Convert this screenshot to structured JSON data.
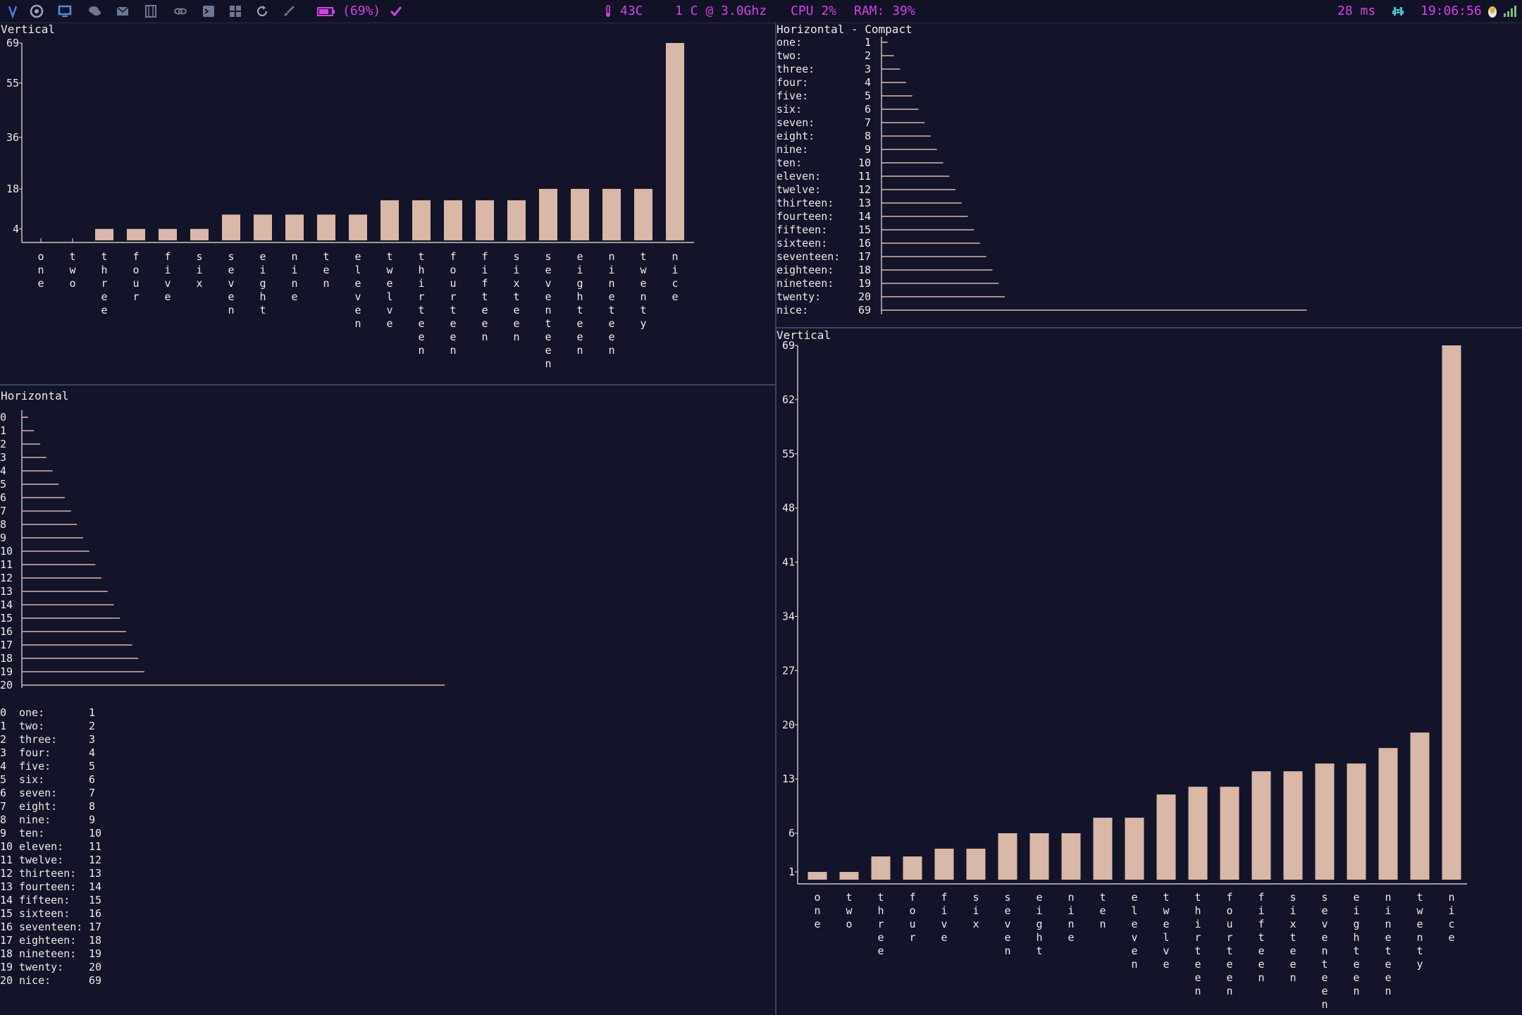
{
  "statusbar": {
    "battery": "(69%)",
    "temperature": "43C",
    "cpu_freq": "1 C @ 3.0Ghz",
    "cpu": "CPU 2%",
    "ram": "RAM: 39%",
    "latency": "28 ms",
    "clock": "19:06:56",
    "icons": [
      "vim-icon",
      "chrome-icon",
      "monitor-icon",
      "chat-icon",
      "mail-icon",
      "film-icon",
      "link-icon",
      "terminal-icon",
      "windows-icon",
      "refresh-icon",
      "brush-icon"
    ]
  },
  "colors": {
    "background": "#13132a",
    "bar": "#d9b8a8",
    "text": "#f2ebe2",
    "accent": "#d443e6",
    "separator": "#3c4460"
  },
  "panes": {
    "top_left": {
      "title": "Vertical"
    },
    "bottom_left": {
      "title": "Horizontal"
    },
    "top_right": {
      "title": "Horizontal - Compact"
    },
    "bottom_right": {
      "title": "Vertical"
    }
  },
  "chart_data": [
    {
      "type": "bar",
      "orientation": "vertical",
      "categories": [
        "one",
        "two",
        "three",
        "four",
        "five",
        "six",
        "seven",
        "eight",
        "nine",
        "ten",
        "eleven",
        "twelve",
        "thirteen",
        "fourteen",
        "fifteen",
        "sixteen",
        "seventeen",
        "eighteen",
        "nineteen",
        "twenty",
        "nice"
      ],
      "values": [
        0,
        0,
        4,
        4,
        4,
        4,
        9,
        9,
        9,
        9,
        9,
        14,
        14,
        14,
        14,
        14,
        18,
        18,
        18,
        18,
        69
      ],
      "yticks": [
        4,
        18,
        36,
        55,
        69
      ],
      "ylim": [
        0,
        69
      ]
    },
    {
      "type": "bar",
      "orientation": "horizontal",
      "categories": [
        "0",
        "1",
        "2",
        "3",
        "4",
        "5",
        "6",
        "7",
        "8",
        "9",
        "10",
        "11",
        "12",
        "13",
        "14",
        "15",
        "16",
        "17",
        "18",
        "19",
        "20"
      ],
      "values": [
        1,
        2,
        3,
        4,
        5,
        6,
        7,
        8,
        9,
        10,
        11,
        12,
        13,
        14,
        15,
        16,
        17,
        18,
        19,
        20,
        69
      ],
      "table": {
        "index": [
          "0",
          "1",
          "2",
          "3",
          "4",
          "5",
          "6",
          "7",
          "8",
          "9",
          "10",
          "11",
          "12",
          "13",
          "14",
          "15",
          "16",
          "17",
          "18",
          "19",
          "20"
        ],
        "labels": [
          "one:",
          "two:",
          "three:",
          "four:",
          "five:",
          "six:",
          "seven:",
          "eight:",
          "nine:",
          "ten:",
          "eleven:",
          "twelve:",
          "thirteen:",
          "fourteen:",
          "fifteen:",
          "sixteen:",
          "seventeen:",
          "eighteen:",
          "nineteen:",
          "twenty:",
          "nice:"
        ],
        "values": [
          "1",
          "2",
          "3",
          "4",
          "5",
          "6",
          "7",
          "8",
          "9",
          "10",
          "11",
          "12",
          "13",
          "14",
          "15",
          "16",
          "17",
          "18",
          "19",
          "20",
          "69"
        ]
      }
    },
    {
      "type": "bar",
      "orientation": "horizontal",
      "categories": [
        "one:",
        "two:",
        "three:",
        "four:",
        "five:",
        "six:",
        "seven:",
        "eight:",
        "nine:",
        "ten:",
        "eleven:",
        "twelve:",
        "thirteen:",
        "fourteen:",
        "fifteen:",
        "sixteen:",
        "seventeen:",
        "eighteen:",
        "nineteen:",
        "twenty:",
        "nice:"
      ],
      "values": [
        1,
        2,
        3,
        4,
        5,
        6,
        7,
        8,
        9,
        10,
        11,
        12,
        13,
        14,
        15,
        16,
        17,
        18,
        19,
        20,
        69
      ]
    },
    {
      "type": "bar",
      "orientation": "vertical",
      "categories": [
        "one",
        "two",
        "three",
        "four",
        "five",
        "six",
        "seven",
        "eight",
        "nine",
        "ten",
        "eleven",
        "twelve",
        "thirteen",
        "fourteen",
        "fifteen",
        "sixteen",
        "seventeen",
        "eighteen",
        "nineteen",
        "twenty",
        "nice"
      ],
      "values": [
        1,
        1,
        3,
        3,
        4,
        4,
        6,
        6,
        6,
        8,
        8,
        11,
        12,
        12,
        14,
        14,
        15,
        15,
        17,
        19,
        69
      ],
      "yticks": [
        1,
        6,
        13,
        20,
        27,
        34,
        41,
        48,
        55,
        62,
        69
      ],
      "ylim": [
        0,
        69
      ]
    }
  ]
}
